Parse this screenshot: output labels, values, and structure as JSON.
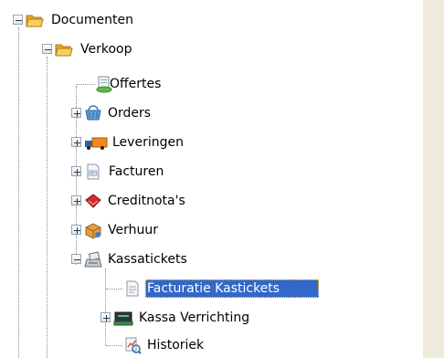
{
  "tree": {
    "root": {
      "label": "Documenten",
      "icon": "open-folder-icon",
      "expanded": true
    },
    "group": {
      "label": "Verkoop",
      "icon": "open-folder-icon",
      "expanded": true
    },
    "items": [
      {
        "label": "Offertes",
        "icon": "quote-document-icon"
      },
      {
        "label": "Orders",
        "icon": "basket-icon"
      },
      {
        "label": "Leveringen",
        "icon": "delivery-truck-icon"
      },
      {
        "label": "Facturen",
        "icon": "invoice-document-icon"
      },
      {
        "label": "Creditnota's",
        "icon": "credit-note-icon"
      },
      {
        "label": "Verhuur",
        "icon": "rental-box-icon"
      },
      {
        "label": "Kassatickets",
        "icon": "cash-register-icon",
        "expanded": true
      }
    ],
    "subitems": [
      {
        "label": "Facturatie Kastickets",
        "icon": "document-icon",
        "selected": true
      },
      {
        "label": "Kassa Verrichting",
        "icon": "cash-drawer-icon"
      },
      {
        "label": "Historiek",
        "icon": "history-chart-icon"
      }
    ]
  },
  "colors": {
    "selection": "#3268c8",
    "side_panel": "#eeeadc",
    "folder": "#f0b030"
  }
}
